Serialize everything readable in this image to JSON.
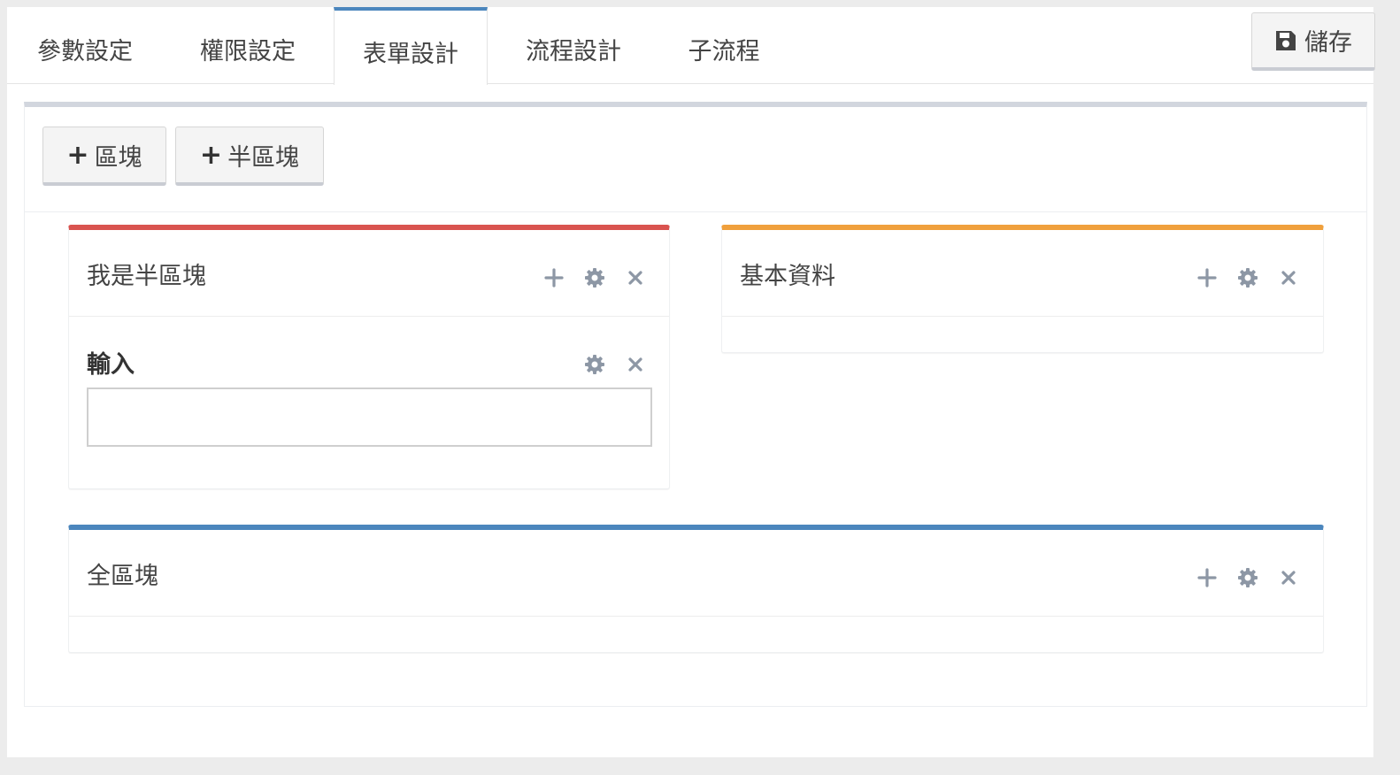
{
  "tabs": [
    {
      "label": "參數設定"
    },
    {
      "label": "權限設定"
    },
    {
      "label": "表單設計"
    },
    {
      "label": "流程設計"
    },
    {
      "label": "子流程"
    }
  ],
  "active_tab": "表單設計",
  "save_button": {
    "label": "儲存",
    "icon": "floppy-disk-icon"
  },
  "toolbar": {
    "add_block_label": "區塊",
    "add_half_block_label": "半區塊"
  },
  "panels": {
    "half_block": {
      "title": "我是半區塊",
      "color": "#d9534f"
    },
    "basic_info": {
      "title": "基本資料",
      "color": "#f0a03c"
    },
    "full_block": {
      "title": "全區塊",
      "color": "#4b86bd"
    }
  },
  "field": {
    "label": "輸入",
    "value": ""
  },
  "icons": {
    "add": "plus-icon",
    "settings": "gear-icon",
    "remove": "close-icon"
  },
  "colors": {
    "tool_icon": "#8d97a5",
    "tab_active": "#4b86bd"
  }
}
